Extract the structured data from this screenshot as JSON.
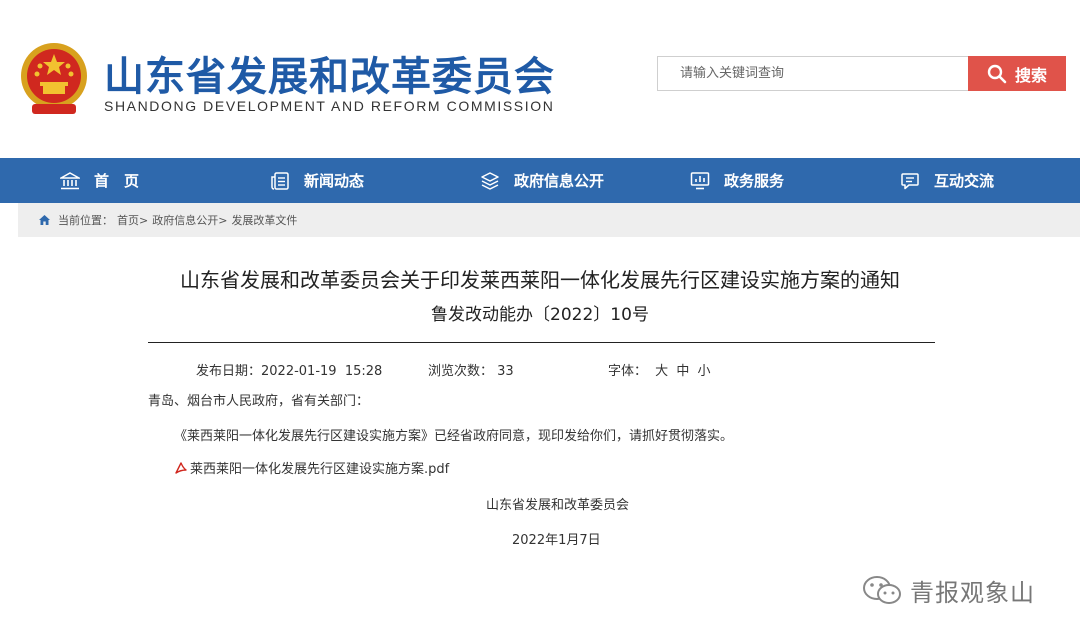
{
  "site": {
    "title": "山东省发展和改革委员会",
    "subtitle": "SHANDONG DEVELOPMENT AND REFORM COMMISSION"
  },
  "search": {
    "placeholder": "请输入关键词查询",
    "button_label": "搜索"
  },
  "nav": {
    "items": [
      {
        "label": "首　页",
        "icon": "bank-icon"
      },
      {
        "label": "新闻动态",
        "icon": "news-icon"
      },
      {
        "label": "政府信息公开",
        "icon": "layers-icon"
      },
      {
        "label": "政务服务",
        "icon": "chart-icon"
      },
      {
        "label": "互动交流",
        "icon": "chat-icon"
      }
    ]
  },
  "breadcrumb": {
    "prefix": "当前位置：",
    "items": [
      "首页>",
      "政府信息公开>",
      "发展改革文件"
    ]
  },
  "article": {
    "title": "山东省发展和改革委员会关于印发莱西莱阳一体化发展先行区建设实施方案的通知",
    "doc_number": "鲁发改动能办〔2022〕10号",
    "meta": {
      "publish_label": "发布日期：",
      "publish_date": "2022-01-19  15:28",
      "views_label": "浏览次数：",
      "views": "33",
      "font_label": "字体：",
      "font_sizes": [
        "大",
        "中",
        "小"
      ]
    },
    "salutation": "青岛、烟台市人民政府，省有关部门：",
    "body": "《莱西莱阳一体化发展先行区建设实施方案》已经省政府同意，现印发给你们，请抓好贯彻落实。",
    "attachment": "莱西莱阳一体化发展先行区建设实施方案.pdf",
    "signature": "山东省发展和改革委员会",
    "date": "2022年1月7日"
  },
  "watermark": {
    "text": "青报观象山"
  },
  "colors": {
    "brand_blue": "#1f5aa6",
    "nav_blue": "#2f69ad",
    "search_red": "#e0534a"
  }
}
